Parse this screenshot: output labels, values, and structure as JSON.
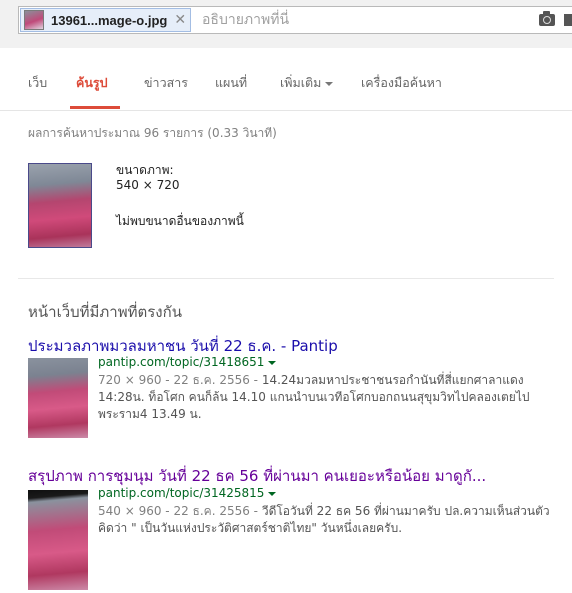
{
  "search": {
    "chip_filename": "13961...mage-o.jpg",
    "description_placeholder": "อธิบายภาพที่นี่"
  },
  "tabs": [
    {
      "label": "เว็บ"
    },
    {
      "label": "ค้นรูป"
    },
    {
      "label": "ข่าวสาร"
    },
    {
      "label": "แผนที่"
    },
    {
      "label": "เพิ่มเติม"
    },
    {
      "label": "เครื่องมือค้นหา"
    }
  ],
  "stats": "ผลการค้นหาประมาณ 96 รายการ (0.33 วินาที)",
  "image_info": {
    "size_label": "ขนาดภาพ:",
    "size_value": "540 × 720",
    "no_other_sizes": "ไม่พบขนาดอื่นของภาพนี้"
  },
  "section_title": "หน้าเว็บที่มีภาพที่ตรงกัน",
  "results": [
    {
      "title": "ประมวลภาพมวลมหาชน วันที่ 22 ธ.ค. - Pantip",
      "url": "pantip.com/topic/31418651",
      "meta": "720 × 960 - 22 ธ.ค. 2556 - ",
      "snippet_line1": "14.24มวลมหาประชาชนรอกำนันที่สี่แยกศาลาแดง",
      "snippet_line2": "14:28น. ท็อโศก คนก็ล้น 14.10 แกนนำบนเวทีอโศกบอกถนนสุขุมวิทไปคลองเตยไป",
      "snippet_line3": "พระราม4 13.49 น."
    },
    {
      "title": "สรุปภาพ การชุมนุม วันที่ 22 ธค 56 ที่ผ่านมา คนเยอะหรือน้อย มาดูกั...",
      "url": "pantip.com/topic/31425815",
      "meta": "540 × 960 - 22 ธ.ค. 2556 - ",
      "snippet_line1": "วีดีโอวันที่ 22 ธค 56 ที่ผ่านมาครับ ปล.ความเห็นส่วนตัว",
      "snippet_line2": "คิดว่า \" เป็นวันแห่งประวัติศาสตร์ชาติไทย\" วันหนึ่งเลยครับ."
    }
  ]
}
